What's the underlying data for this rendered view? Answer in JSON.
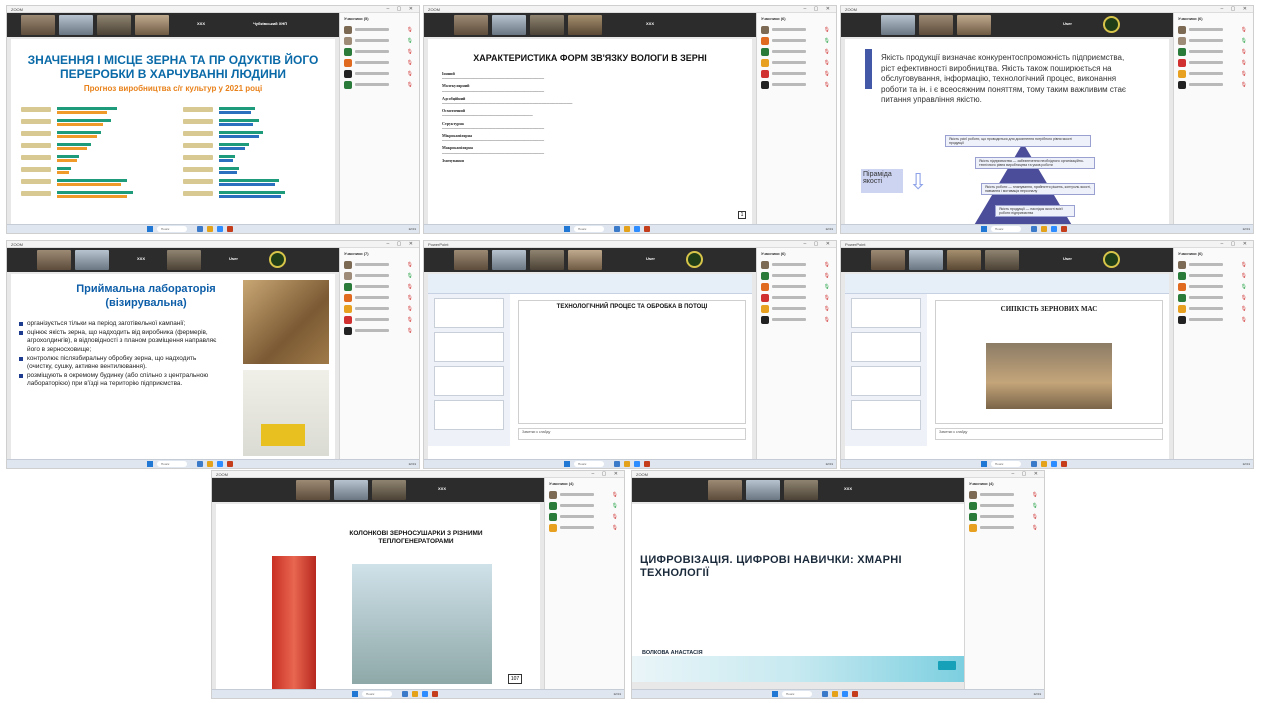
{
  "tiles": [
    {
      "title": "ZOOM",
      "tag": "XXX",
      "tag2": "Чубківський ХНП",
      "panel_head": "Учасники (5)",
      "slide": {
        "title": "ЗНАЧЕННЯ І МІСЦЕ ЗЕРНА ТА ПР ОДУКТІВ ЙОГО ПЕРЕРОБКИ В ХАРЧУВАННІ ЛЮДИНИ",
        "subtitle": "Прогноз виробництва с/г культур у 2021 році"
      }
    },
    {
      "title": "ZOOM",
      "tag": "XXX",
      "panel_head": "Учасники (6)",
      "slide": {
        "title": "ХАРАКТЕРИСТИКА ФОРМ ЗВ'ЯЗКУ ВОЛОГИ В ЗЕРНІ",
        "sections": [
          "Іонний",
          "Молекулярний",
          "Адсобційний",
          "Осмотичний",
          "Структурна",
          "Мікрокапілярна",
          "Макрокапілярна",
          "Змочування"
        ],
        "page": "1"
      }
    },
    {
      "title": "ZOOM",
      "tag": "User",
      "panel_head": "Учасники (6)",
      "slide": {
        "text": "Якість продукції визначає конкурентоспроможність підприємства, ріст ефективності виробництва. Якість також поширюється на обслуговування, інформацію, технологічний процес, виконання роботи та ін. і є всеосяжним поняттям, тому таким важливим стає питання управління якістю.",
        "box1": "Якість усієї роботи, що проводиться для досягнення потрібного рівня якості продукції",
        "box2": "Якість підприємства — забезпечення необхідного організаційно-технічного рівня виробництва та умов роботи",
        "box3": "Якість роботи — планування, прийняття рішень, контроль якості, навчання і мотивація персоналу",
        "box4": "Якість продукції — наслідок якості всієї роботи підприємства",
        "label": "Піраміда якості"
      }
    },
    {
      "title": "ZOOM",
      "tag": "XXX",
      "tag2": "User",
      "panel_head": "Учасники (7)",
      "slide": {
        "title": "Приймальна лабораторія (візирувальна)",
        "items": [
          "організується тільки на період заготівельної кампанії;",
          "оцінює якість зерна, що надходить від виробника (фермерів, агрохолдингів), в відповідності з планом розміщення направляє його в зерносховище;",
          "контролює післязбиральну обробку зерна, що надходить (очистку, сушку, активне вентилювання).",
          "розміщують в окремому будинку (або спільно з центральною лабораторією) при в'їзді на територію підприємства."
        ]
      }
    },
    {
      "title": "PowerPoint",
      "tag": "User",
      "panel_head": "Учасники (6)",
      "slide": {
        "title": "ТЕХНОЛОГІЧНИЙ ПРОЦЕС ТА ОБРОБКА В ПОТОЦІ",
        "notes": "Заметки к слайду"
      }
    },
    {
      "title": "PowerPoint",
      "tag": "User",
      "panel_head": "Учасники (6)",
      "slide": {
        "title": "СИПКІСТЬ ЗЕРНОВИХ МАС",
        "notes": "Заметки к слайду"
      }
    },
    {
      "title": "ZOOM",
      "tag": "XXX",
      "panel_head": "Учасники (4)",
      "slide": {
        "title": "КОЛОНКОВІ ЗЕРНОСУШАРКИ З РІЗНИМИ ТЕПЛОГЕНЕРАТОРАМИ",
        "page": "107"
      }
    },
    {
      "title": "ZOOM",
      "tag": "XXX",
      "panel_head": "Учасники (4)",
      "slide": {
        "title": "ЦИФРОВІЗАЦІЯ. ЦИФРОВІ НАВИЧКИ: ХМАРНІ ТЕХНОЛОГІЇ",
        "author": "ВОЛКОВА АНАСТАСІЯ"
      }
    }
  ],
  "panel_buttons": [
    "Пригласить",
    "Включить звук для всех"
  ],
  "taskbar": {
    "search": "Поиск",
    "clock": "12:01"
  },
  "colors": {
    "accent": "#0a6aa8",
    "orange": "#e8811a",
    "dark_strip": "#2c2c2c",
    "taskbar": "#dfe6ef"
  }
}
